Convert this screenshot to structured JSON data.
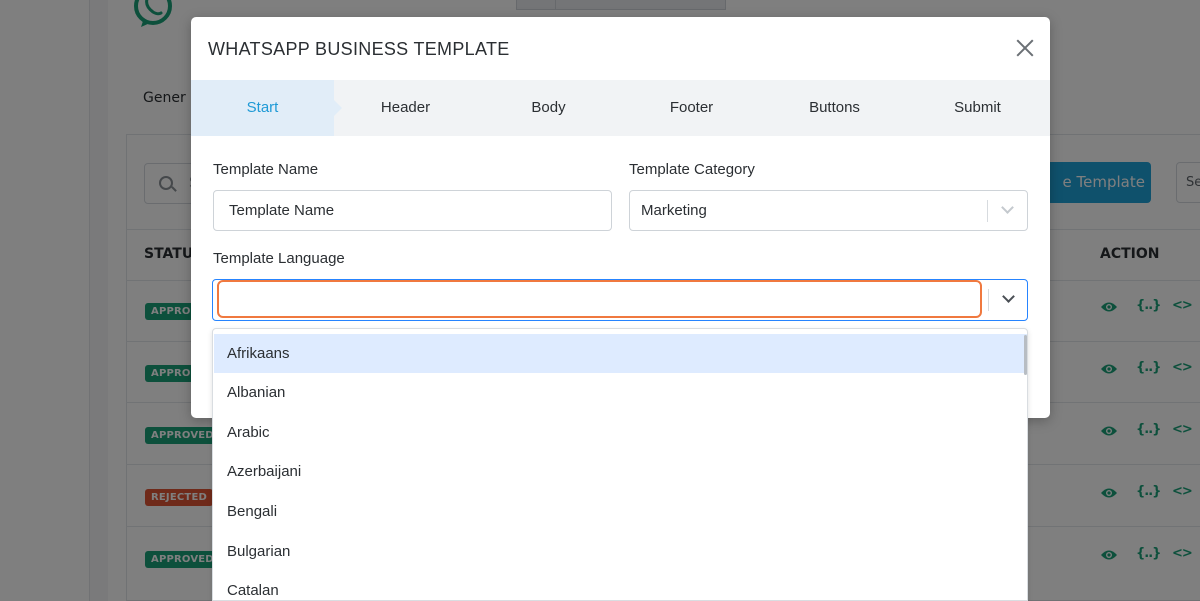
{
  "background": {
    "general_tab": "Gener",
    "search_letter": "S",
    "create_button": "e Template",
    "right_select": "Se",
    "status_header": "STATU",
    "action_header": "ACTION",
    "badges": [
      {
        "label": "APPRO",
        "color": "#1aa179"
      },
      {
        "label": "APPRO",
        "color": "#1aa179"
      },
      {
        "label": "APPROVED",
        "color": "#1aa179"
      },
      {
        "label": "REJECTED",
        "color": "#de5535"
      },
      {
        "label": "APPROVED",
        "color": "#1aa179"
      }
    ],
    "action_icons": [
      "eye-icon",
      "braces-icon",
      "code-icon"
    ],
    "braces_glyph": "{..}",
    "code_glyph": "<>"
  },
  "modal": {
    "title": "WHATSAPP BUSINESS TEMPLATE",
    "steps": [
      "Start",
      "Header",
      "Body",
      "Footer",
      "Buttons",
      "Submit"
    ],
    "active_step": "Start",
    "template_name_label": "Template Name",
    "template_name_placeholder": "Template Name",
    "template_category_label": "Template Category",
    "template_category_value": "Marketing",
    "template_language_label": "Template Language",
    "template_language_value": ""
  },
  "language_menu": {
    "options": [
      "Afrikaans",
      "Albanian",
      "Arabic",
      "Azerbaijani",
      "Bengali",
      "Bulgarian",
      "Catalan"
    ],
    "highlighted": "Afrikaans"
  },
  "colors": {
    "accent": "#1f9ad6",
    "approved": "#1aa179",
    "rejected": "#de5535",
    "focus_border": "#2684ff",
    "input_highlight": "#f0793f"
  }
}
